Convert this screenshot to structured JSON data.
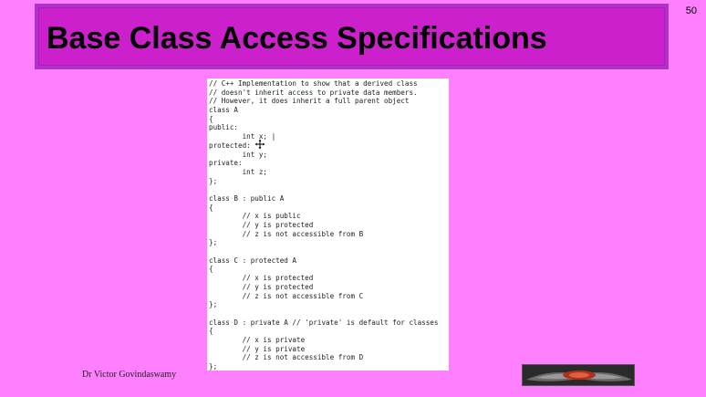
{
  "slide": {
    "title": "Base Class Access Specifications",
    "page_number": "50",
    "author": "Dr Victor Govindaswamy",
    "colors": {
      "background": "#ff80ff",
      "title_bar": "#cc20cc",
      "title_border": "#b030c8",
      "code_background": "#ffffff"
    }
  },
  "code": {
    "lines": [
      "// C++ Implementation to show that a derived class",
      "// doesn't inherit access to private data members.",
      "// However, it does inherit a full parent object",
      "class A",
      "{",
      "public:",
      "        int x; |",
      "protected:",
      "        int y;",
      "private:",
      "        int z;",
      "};",
      "",
      "class B : public A",
      "{",
      "        // x is public",
      "        // y is protected",
      "        // z is not accessible from B",
      "};",
      "",
      "class C : protected A",
      "{",
      "        // x is protected",
      "        // y is protected",
      "        // z is not accessible from C",
      "};",
      "",
      "class D : private A // 'private' is default for classes",
      "{",
      "        // x is private",
      "        // y is private",
      "        // z is not accessible from D",
      "};"
    ]
  },
  "icons": {
    "cursor": "move-cursor-icon",
    "logo": "logo-banner"
  }
}
